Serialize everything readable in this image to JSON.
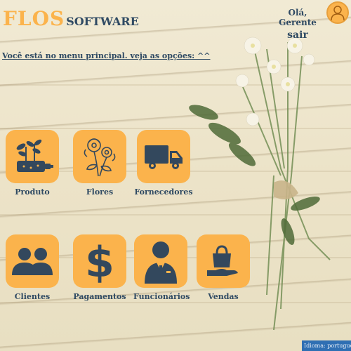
{
  "header": {
    "logo_main": "FLOS",
    "logo_sub": "SOFTWARE",
    "greeting": "Olá, Gerente",
    "logout_label": "sair"
  },
  "menu_hint": "Você está no menu principal. veja as opções:  ^^",
  "tiles": [
    {
      "label": "Produto",
      "icon": "plant-box-icon"
    },
    {
      "label": "Flores",
      "icon": "flower-icon"
    },
    {
      "label": "Fornecedores",
      "icon": "truck-icon"
    },
    {
      "label": "Clientes",
      "icon": "users-icon"
    },
    {
      "label": "Pagamentos",
      "icon": "dollar-icon"
    },
    {
      "label": "Funcionários",
      "icon": "employee-icon"
    },
    {
      "label": "Vendas",
      "icon": "shopping-bag-hand-icon"
    }
  ],
  "footer": {
    "language": "Idioma: português"
  },
  "colors": {
    "accent": "#fbb34c",
    "text": "#2f4a63",
    "icon": "#33485d",
    "footer_bg": "#2f6fb3"
  }
}
